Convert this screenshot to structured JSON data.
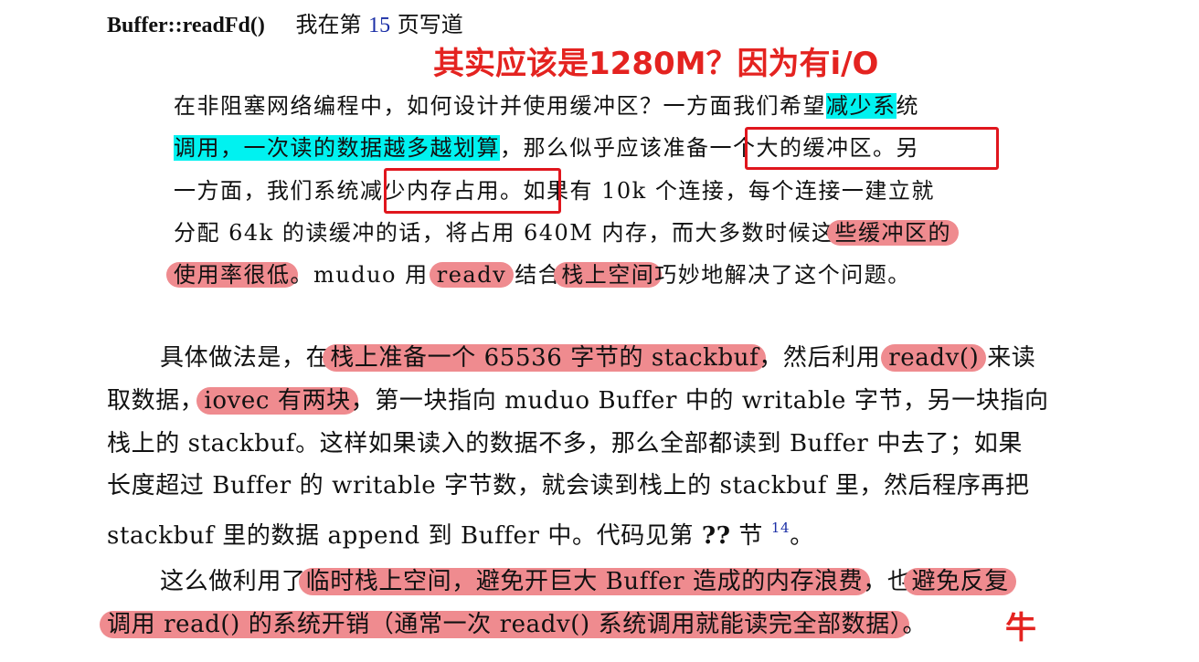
{
  "heading": {
    "func": "Buffer::readFd()",
    "note_pre": "我在第",
    "page": "15",
    "note_post": "页写道"
  },
  "comment_top": "其实应该是1280M？因为有i/O",
  "comment_bottom": "牛",
  "quote": {
    "l1_a": "在非阻塞网络编程中，如何设计并使用缓冲区？一方面我们希望",
    "l1_hl": "减少系",
    "l1_b": "统",
    "l2_hl": "调用，一次读的数据越多越划算",
    "l2_a": "，那么似乎应该",
    "l2_box": "准备一个大的缓冲区",
    "l2_b": "。另",
    "l3_a": "一方面，我们系统",
    "l3_box": "减少内存占用",
    "l3_b": "。如果有 10k 个连接，每个连接一建立就",
    "l4_a": "分配 64k 的读缓冲的话，将占用 640M 内存，而大多数时候这",
    "l4_hl": "些缓冲区的",
    "l5_hl": "使用率很低",
    "l5_a": "。muduo 用 ",
    "l5_hl2": "readv",
    "l5_b": " 结合",
    "l5_hl3": "栈上空间",
    "l5_c": "巧妙地解决了这个问题。"
  },
  "body1": {
    "l1_a": "具体做法是，在",
    "l1_hl": "栈上准备一个 65536 字节的 stackbuf",
    "l1_b": "，然后利用 ",
    "l1_hl2": "readv()",
    "l1_c": " 来读",
    "l2_a": "取数据，",
    "l2_hl": "iovec 有两块",
    "l2_b": "，第一块指向 muduo Buffer 中的 writable 字节，另一块指向",
    "l3": "栈上的 stackbuf。这样如果读入的数据不多，那么全部都读到 Buffer 中去了；如果",
    "l4": "长度超过 Buffer 的 writable 字节数，就会读到栈上的 stackbuf 里，然后程序再把",
    "l5_a": "stackbuf 里的数据 append 到 Buffer 中。代码见第 ",
    "l5_ref": "??",
    "l5_b": " 节 ",
    "l5_sup": "14",
    "l5_c": "。"
  },
  "body2": {
    "l1_a": "这么做利用了",
    "l1_hl": "临时栈上空间，避免开巨大 Buffer 造成的内存浪费",
    "l1_b": "，也",
    "l1_hl2": "避免反复",
    "l2_hl": "调用 read() 的系统开销（通常一次 readv() 系统调用就能读完全部数据）",
    "l2_b": "。"
  },
  "colors": {
    "cyan_highlight": "#00f2f0",
    "pink_highlight": "#ef8b8f",
    "red_ink": "#e42320",
    "link_blue": "#1b2fa6"
  }
}
